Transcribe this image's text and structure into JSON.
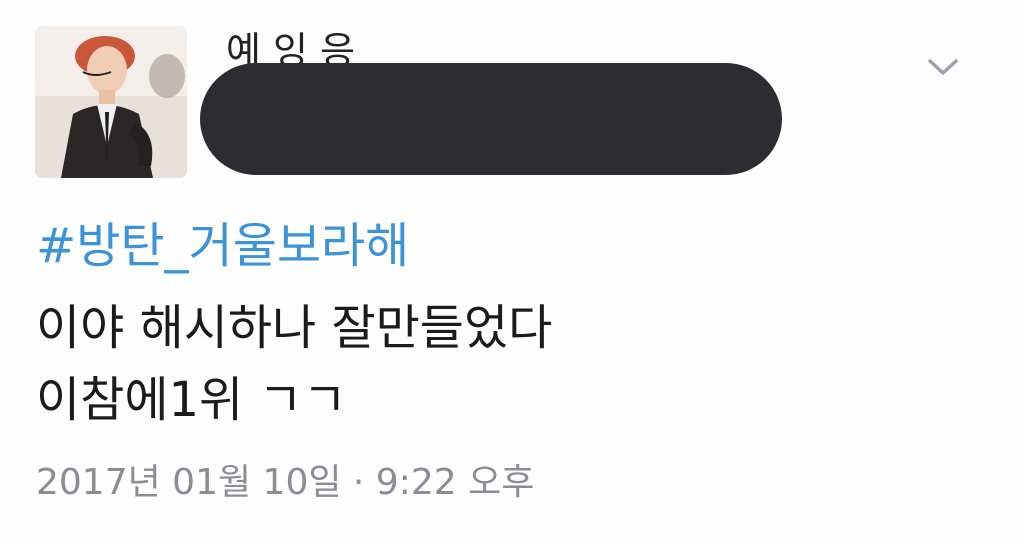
{
  "tweet": {
    "author": {
      "avatar_icon": "profile-photo",
      "display_name_partial": "예 잉 응",
      "handle_redacted": true
    },
    "menu_icon": "chevron-down-icon",
    "hashtag": "#방탄_거울보라해",
    "body_lines": [
      "이야 해시하나 잘만들었다",
      "이참에1위 ㄱㄱ"
    ],
    "timestamp": "2017년 01월 10일 · 9:22 오후"
  },
  "colors": {
    "hashtag": "#3b94d9",
    "text": "#1b1b1b",
    "meta": "#8a8d91",
    "redaction": "#2a2d31"
  }
}
